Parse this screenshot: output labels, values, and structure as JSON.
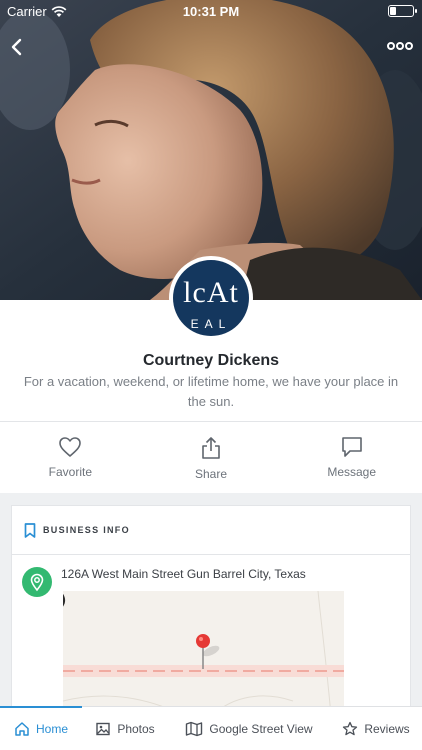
{
  "status_bar": {
    "carrier": "Carrier",
    "time": "10:31 PM"
  },
  "profile": {
    "logo_top": "lcAt",
    "logo_bottom": "EAL",
    "name": "Courtney Dickens",
    "tagline": "For a vacation, weekend, or lifetime home, we have your place in the sun."
  },
  "actions": [
    {
      "label": "Favorite",
      "icon": "heart-icon"
    },
    {
      "label": "Share",
      "icon": "share-icon"
    },
    {
      "label": "Message",
      "icon": "message-icon"
    }
  ],
  "business_info": {
    "title": "BUSINESS INFO",
    "address": "126A West Main Street Gun Barrel City, Texas"
  },
  "tabs": [
    {
      "label": "Home",
      "icon": "home-icon",
      "active": true
    },
    {
      "label": "Photos",
      "icon": "photo-icon",
      "active": false
    },
    {
      "label": "Google Street View",
      "icon": "map-icon",
      "active": false
    },
    {
      "label": "Reviews",
      "icon": "star-icon",
      "active": false
    }
  ],
  "colors": {
    "accent": "#2a8fd4",
    "pin_badge": "#33b971",
    "avatar_bg": "#14375e",
    "map_pin": "#e53935"
  }
}
